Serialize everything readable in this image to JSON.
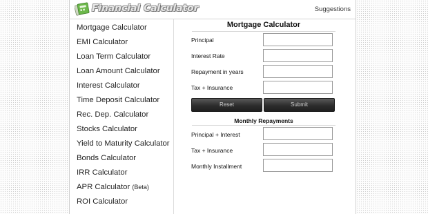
{
  "header": {
    "brand": "Financial Calculator",
    "suggestions": "Suggestions"
  },
  "sidebar": {
    "items": [
      {
        "label": "Mortgage Calculator"
      },
      {
        "label": "EMI Calculator"
      },
      {
        "label": "Loan Term Calculator"
      },
      {
        "label": "Loan Amount Calculator"
      },
      {
        "label": "Interest Calculator"
      },
      {
        "label": "Time Deposit Calculator"
      },
      {
        "label": "Rec. Dep. Calculator"
      },
      {
        "label": "Stocks Calculator"
      },
      {
        "label": "Yield to Maturity Calculator"
      },
      {
        "label": "Bonds Calculator"
      },
      {
        "label": "IRR Calculator"
      },
      {
        "label": "APR Calculator",
        "badge": "(Beta)"
      },
      {
        "label": "ROI Calculator"
      }
    ]
  },
  "calculator": {
    "title": "Mortgage Calculator",
    "fields": [
      {
        "label": "Principal",
        "value": ""
      },
      {
        "label": "Interest Rate",
        "value": ""
      },
      {
        "label": "Repayment in years",
        "value": ""
      },
      {
        "label": "Tax + Insurance",
        "value": ""
      }
    ],
    "reset_label": "Reset",
    "submit_label": "Submit"
  },
  "results": {
    "title": "Monthly Repayments",
    "fields": [
      {
        "label": "Principal + Interest",
        "value": ""
      },
      {
        "label": "Tax + Insurance",
        "value": ""
      },
      {
        "label": "Monthly Installment",
        "value": ""
      }
    ]
  },
  "colors": {
    "button_dark": "#2d2d2d",
    "logo_green": "#6cb84a"
  }
}
